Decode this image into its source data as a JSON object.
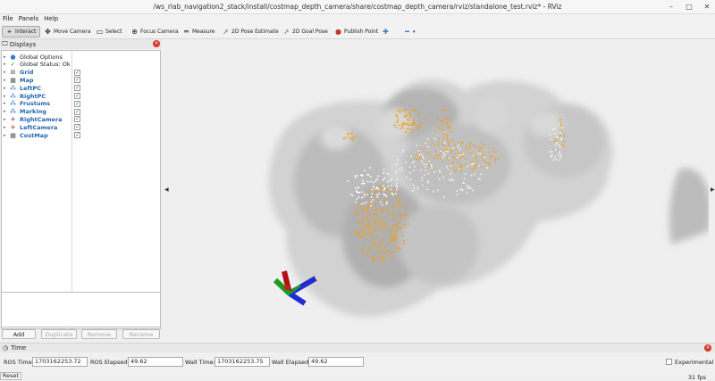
{
  "window": {
    "title": "/ws_rlab_navigation2_stack/install/costmap_depth_camera/share/costmap_depth_camera/rviz/standalone_test.rviz* - RViz"
  },
  "menu": [
    "File",
    "Panels",
    "Help"
  ],
  "toolbar": {
    "interact": "Interact",
    "move_camera": "Move Camera",
    "select": "Select",
    "focus_camera": "Focus Camera",
    "measure": "Measure",
    "pose_estimate": "2D Pose Estimate",
    "goal_pose": "2D Goal Pose",
    "publish_point": "Publish Point"
  },
  "displays": {
    "title": "Displays",
    "items": [
      {
        "label": "Global Options",
        "icon": "globe-icon",
        "checked": null,
        "blue": false
      },
      {
        "label": "Global Status: Ok",
        "icon": "check-icon",
        "checked": null,
        "blue": false
      },
      {
        "label": "Grid",
        "icon": "grid-icon",
        "checked": true,
        "blue": true
      },
      {
        "label": "Map",
        "icon": "map-icon",
        "checked": true,
        "blue": true
      },
      {
        "label": "LeftPC",
        "icon": "pointcloud-icon",
        "checked": true,
        "blue": true
      },
      {
        "label": "RightPC",
        "icon": "pointcloud-icon",
        "checked": true,
        "blue": true
      },
      {
        "label": "Frustums",
        "icon": "pointcloud-icon",
        "checked": true,
        "blue": true
      },
      {
        "label": "Marking",
        "icon": "pointcloud-icon",
        "checked": true,
        "blue": true
      },
      {
        "label": "RightCamera",
        "icon": "camera-icon",
        "checked": true,
        "blue": true
      },
      {
        "label": "LeftCamera",
        "icon": "camera-icon",
        "checked": true,
        "blue": true
      },
      {
        "label": "CostMap",
        "icon": "map-icon",
        "checked": true,
        "blue": true
      }
    ],
    "buttons": {
      "add": "Add",
      "duplicate": "Duplicate",
      "remove": "Remove",
      "rename": "Rename"
    }
  },
  "time": {
    "title": "Time",
    "ros_time_label": "ROS Time:",
    "ros_time": "1703162253.72",
    "ros_elapsed_label": "ROS Elapsed:",
    "ros_elapsed": "49.62",
    "wall_time_label": "Wall Time:",
    "wall_time": "1703162253.75",
    "wall_elapsed_label": "Wall Elapsed:",
    "wall_elapsed": "49.62",
    "experimental_label": "Experimental",
    "reset": "Reset",
    "fps": "31 fps"
  },
  "colors": {
    "accent": "#2265b0",
    "point_cloud": "#f0a020",
    "close_red": "#d9342b"
  }
}
